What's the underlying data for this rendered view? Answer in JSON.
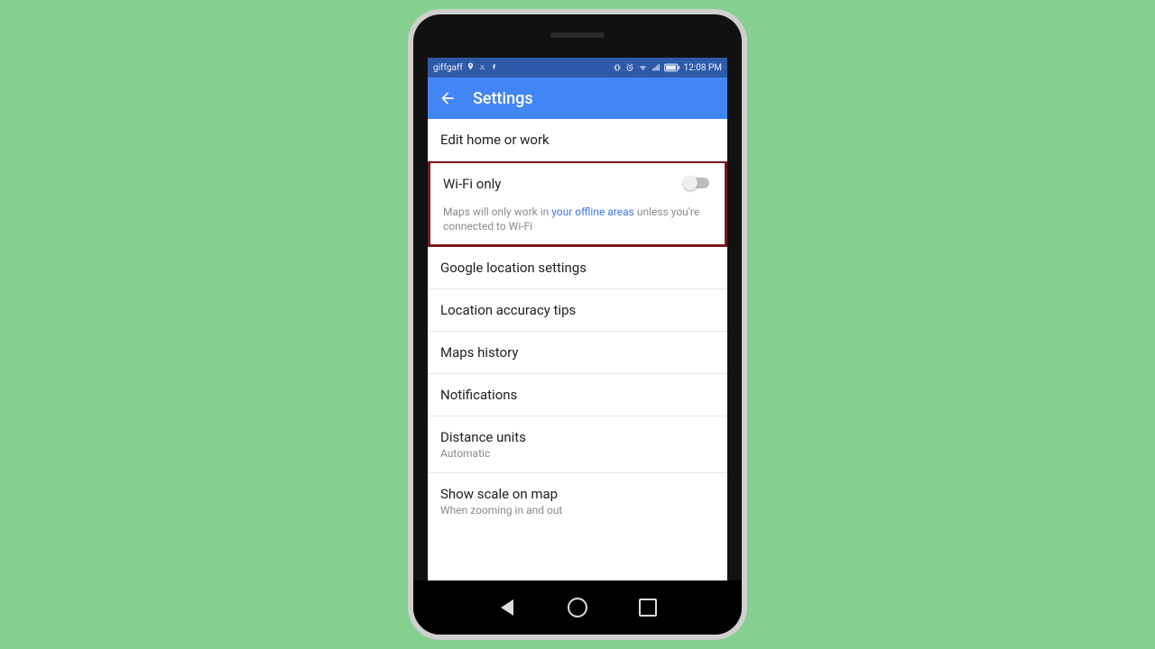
{
  "statusbar": {
    "carrier": "giffgaff",
    "time": "12:08 PM"
  },
  "appbar": {
    "title": "Settings"
  },
  "rows": {
    "edit_home_work": "Edit home or work",
    "wifi_only": {
      "title": "Wi-Fi only",
      "toggle_on": false,
      "desc_pre": "Maps will only work in ",
      "desc_link": "your offline areas",
      "desc_post": " unless you're connected to Wi-Fi"
    },
    "google_location": "Google location settings",
    "location_accuracy": "Location accuracy tips",
    "maps_history": "Maps history",
    "notifications": "Notifications",
    "distance_units": {
      "title": "Distance units",
      "value": "Automatic"
    },
    "show_scale": {
      "title": "Show scale on map",
      "value": "When zooming in and out"
    }
  },
  "colors": {
    "background": "#85cf8f",
    "appbar": "#4285f4",
    "statusbar": "#2f5aa9",
    "highlight_border": "#7a1a1a",
    "link": "#3b78e7"
  }
}
